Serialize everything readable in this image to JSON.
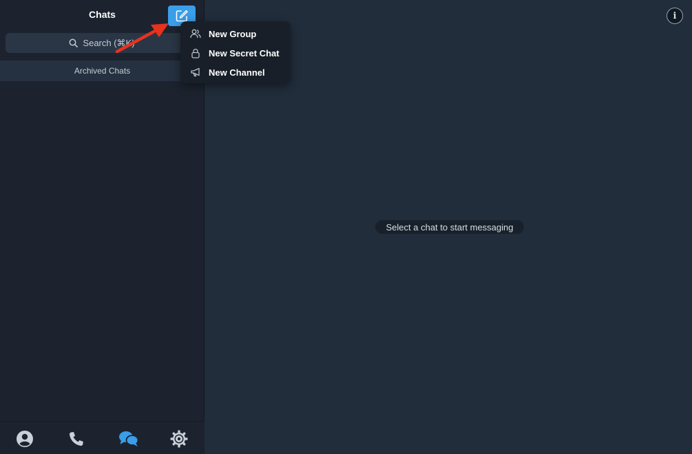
{
  "header": {
    "title": "Chats"
  },
  "search": {
    "placeholder": "Search (⌘K)"
  },
  "archived": {
    "label": "Archived Chats"
  },
  "menu": {
    "items": [
      {
        "label": "New Group",
        "icon": "group-icon"
      },
      {
        "label": "New Secret Chat",
        "icon": "lock-icon"
      },
      {
        "label": "New Channel",
        "icon": "megaphone-icon"
      }
    ]
  },
  "main": {
    "empty_message": "Select a chat to start messaging"
  },
  "bottom_nav": {
    "items": [
      {
        "name": "contacts",
        "icon": "person-icon",
        "active": false
      },
      {
        "name": "calls",
        "icon": "phone-icon",
        "active": false
      },
      {
        "name": "chats",
        "icon": "chat-bubbles-icon",
        "active": true
      },
      {
        "name": "settings",
        "icon": "gear-icon",
        "active": false
      }
    ]
  },
  "colors": {
    "accent": "#3a9ee8",
    "sidebar_bg": "#1c232e",
    "main_bg": "#212d3b",
    "annotation_arrow": "#e8321e"
  }
}
